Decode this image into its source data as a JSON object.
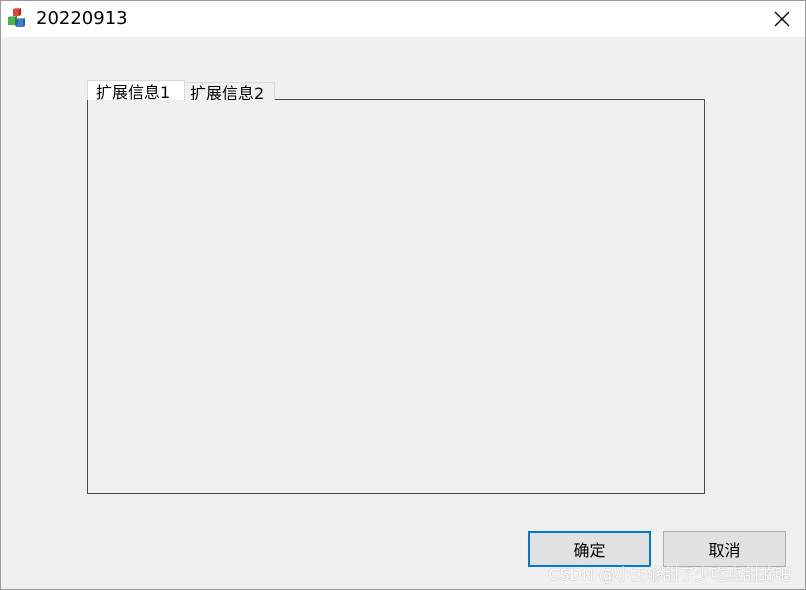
{
  "window": {
    "title": "20220913"
  },
  "tabs": [
    {
      "label": "扩展信息1",
      "selected": true
    },
    {
      "label": "扩展信息2",
      "selected": false
    }
  ],
  "buttons": {
    "ok_label": "确定",
    "cancel_label": "取消"
  },
  "watermark": "CSDN @小王够甜了少吃点甜的吧",
  "icons": {
    "app": "app-cubes-icon",
    "close": "close-icon"
  },
  "colors": {
    "focus_border": "#0078d7",
    "dialog_bg": "#f0f0f0",
    "titlebar_bg": "#ffffff"
  }
}
